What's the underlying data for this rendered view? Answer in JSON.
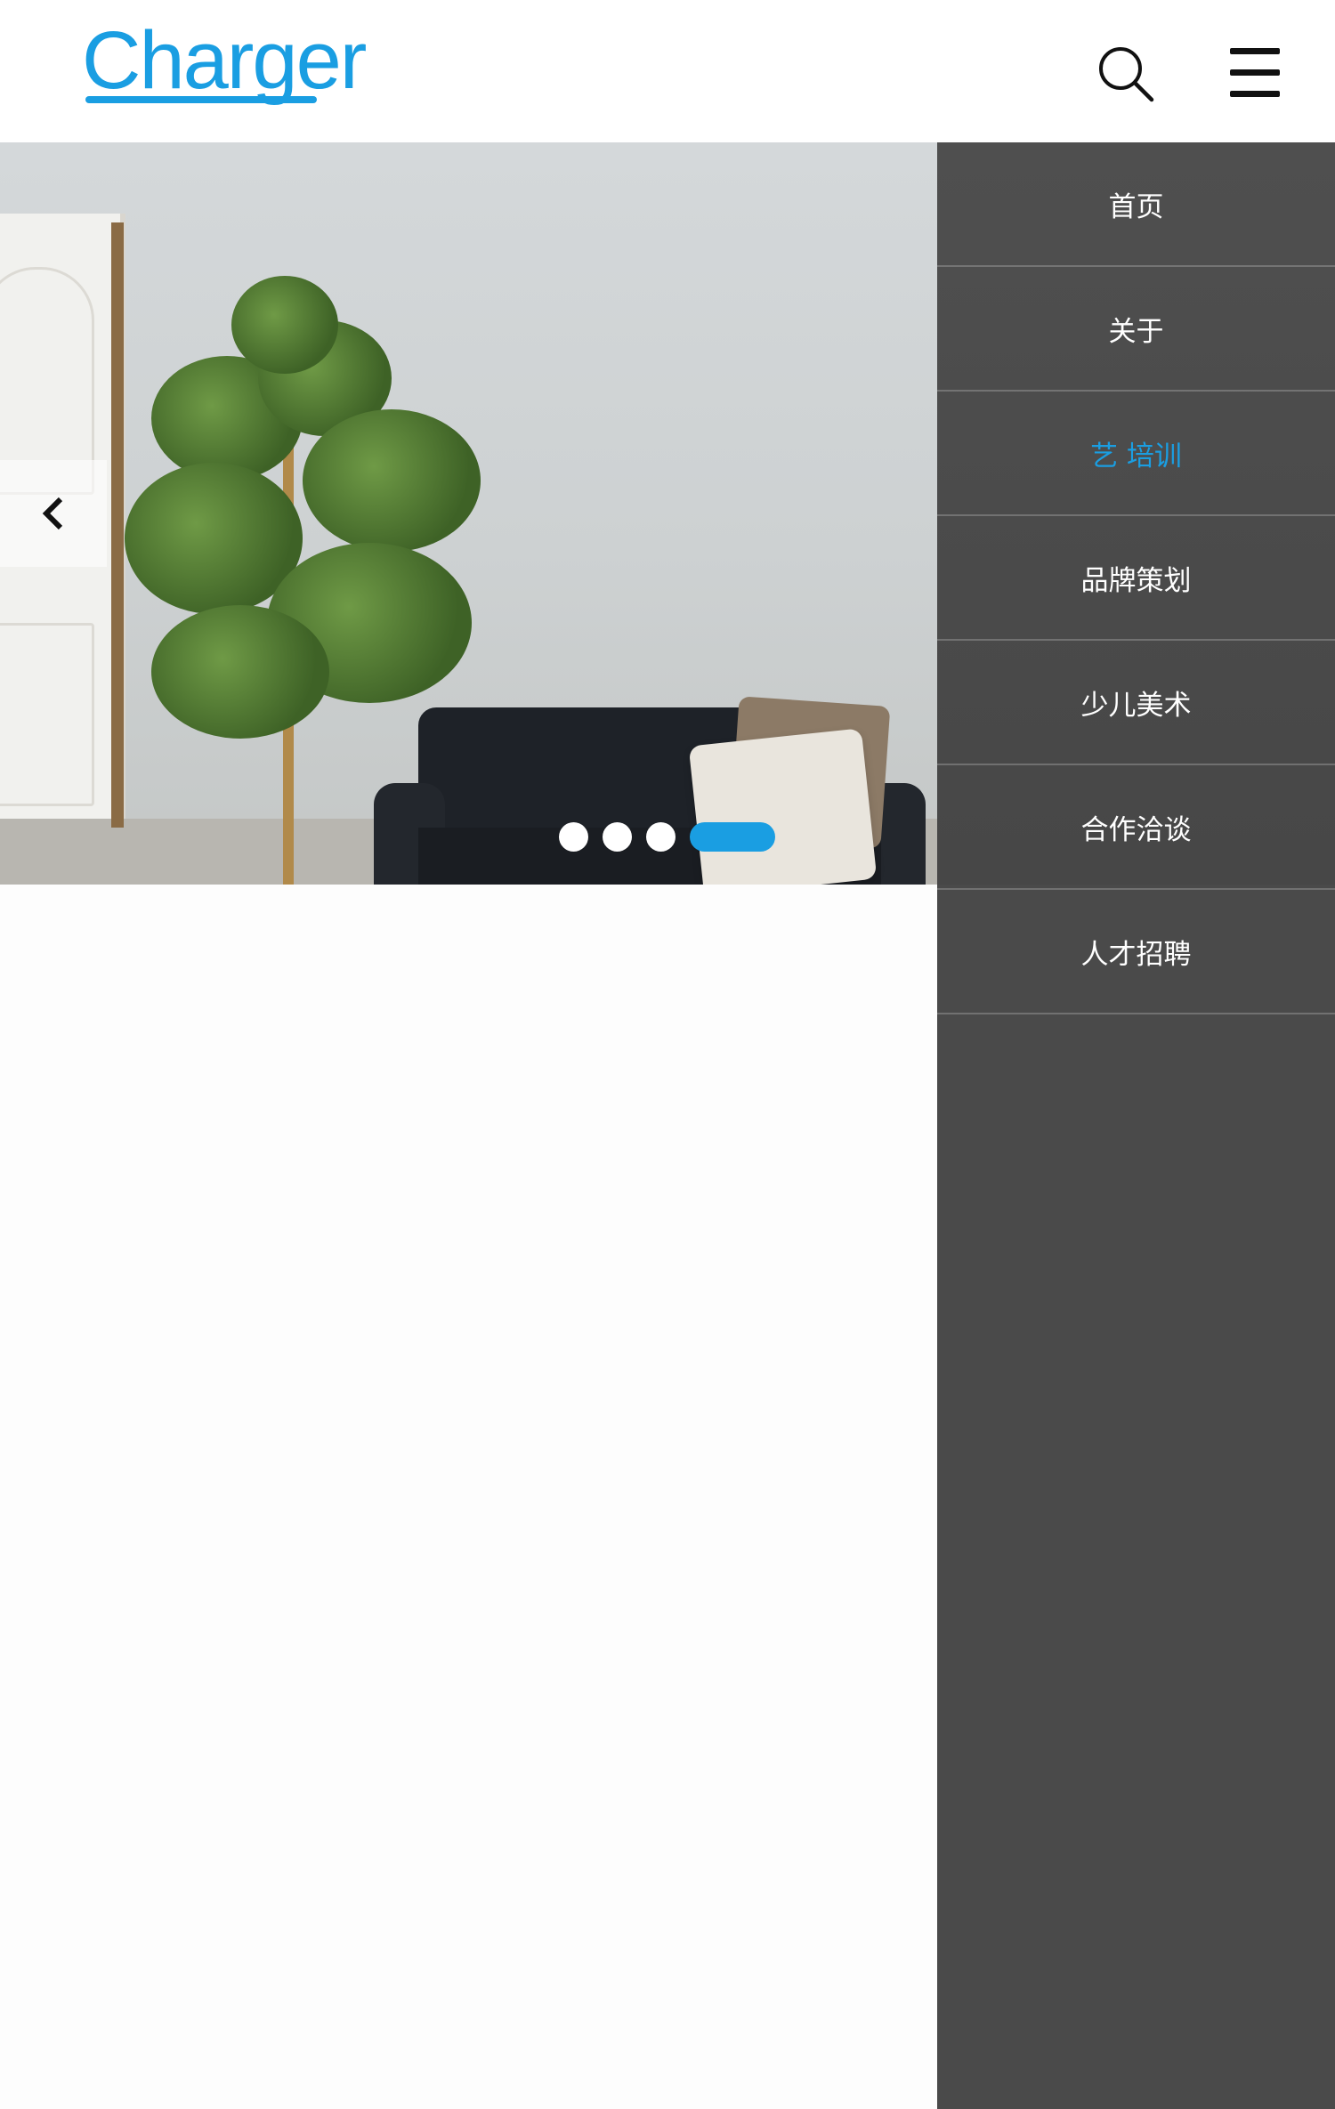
{
  "header": {
    "logo_text": "Charger",
    "search_icon": "search-icon",
    "menu_icon": "hamburger-menu-icon"
  },
  "colors": {
    "accent": "#1a9ee2",
    "drawer_bg": "#4a4a4a",
    "page_bg": "#fdfdfd"
  },
  "slider": {
    "prev_icon": "chevron-left-icon",
    "slide_count": 4,
    "active_slide": 4
  },
  "nav": {
    "items": [
      {
        "label": "首页",
        "active": false
      },
      {
        "label": "关于",
        "active": false
      },
      {
        "label": "艺 培训",
        "active": true
      },
      {
        "label": "品牌策划",
        "active": false
      },
      {
        "label": "少儿美术",
        "active": false
      },
      {
        "label": "合作洽谈",
        "active": false
      },
      {
        "label": "人才招聘",
        "active": false
      }
    ]
  }
}
